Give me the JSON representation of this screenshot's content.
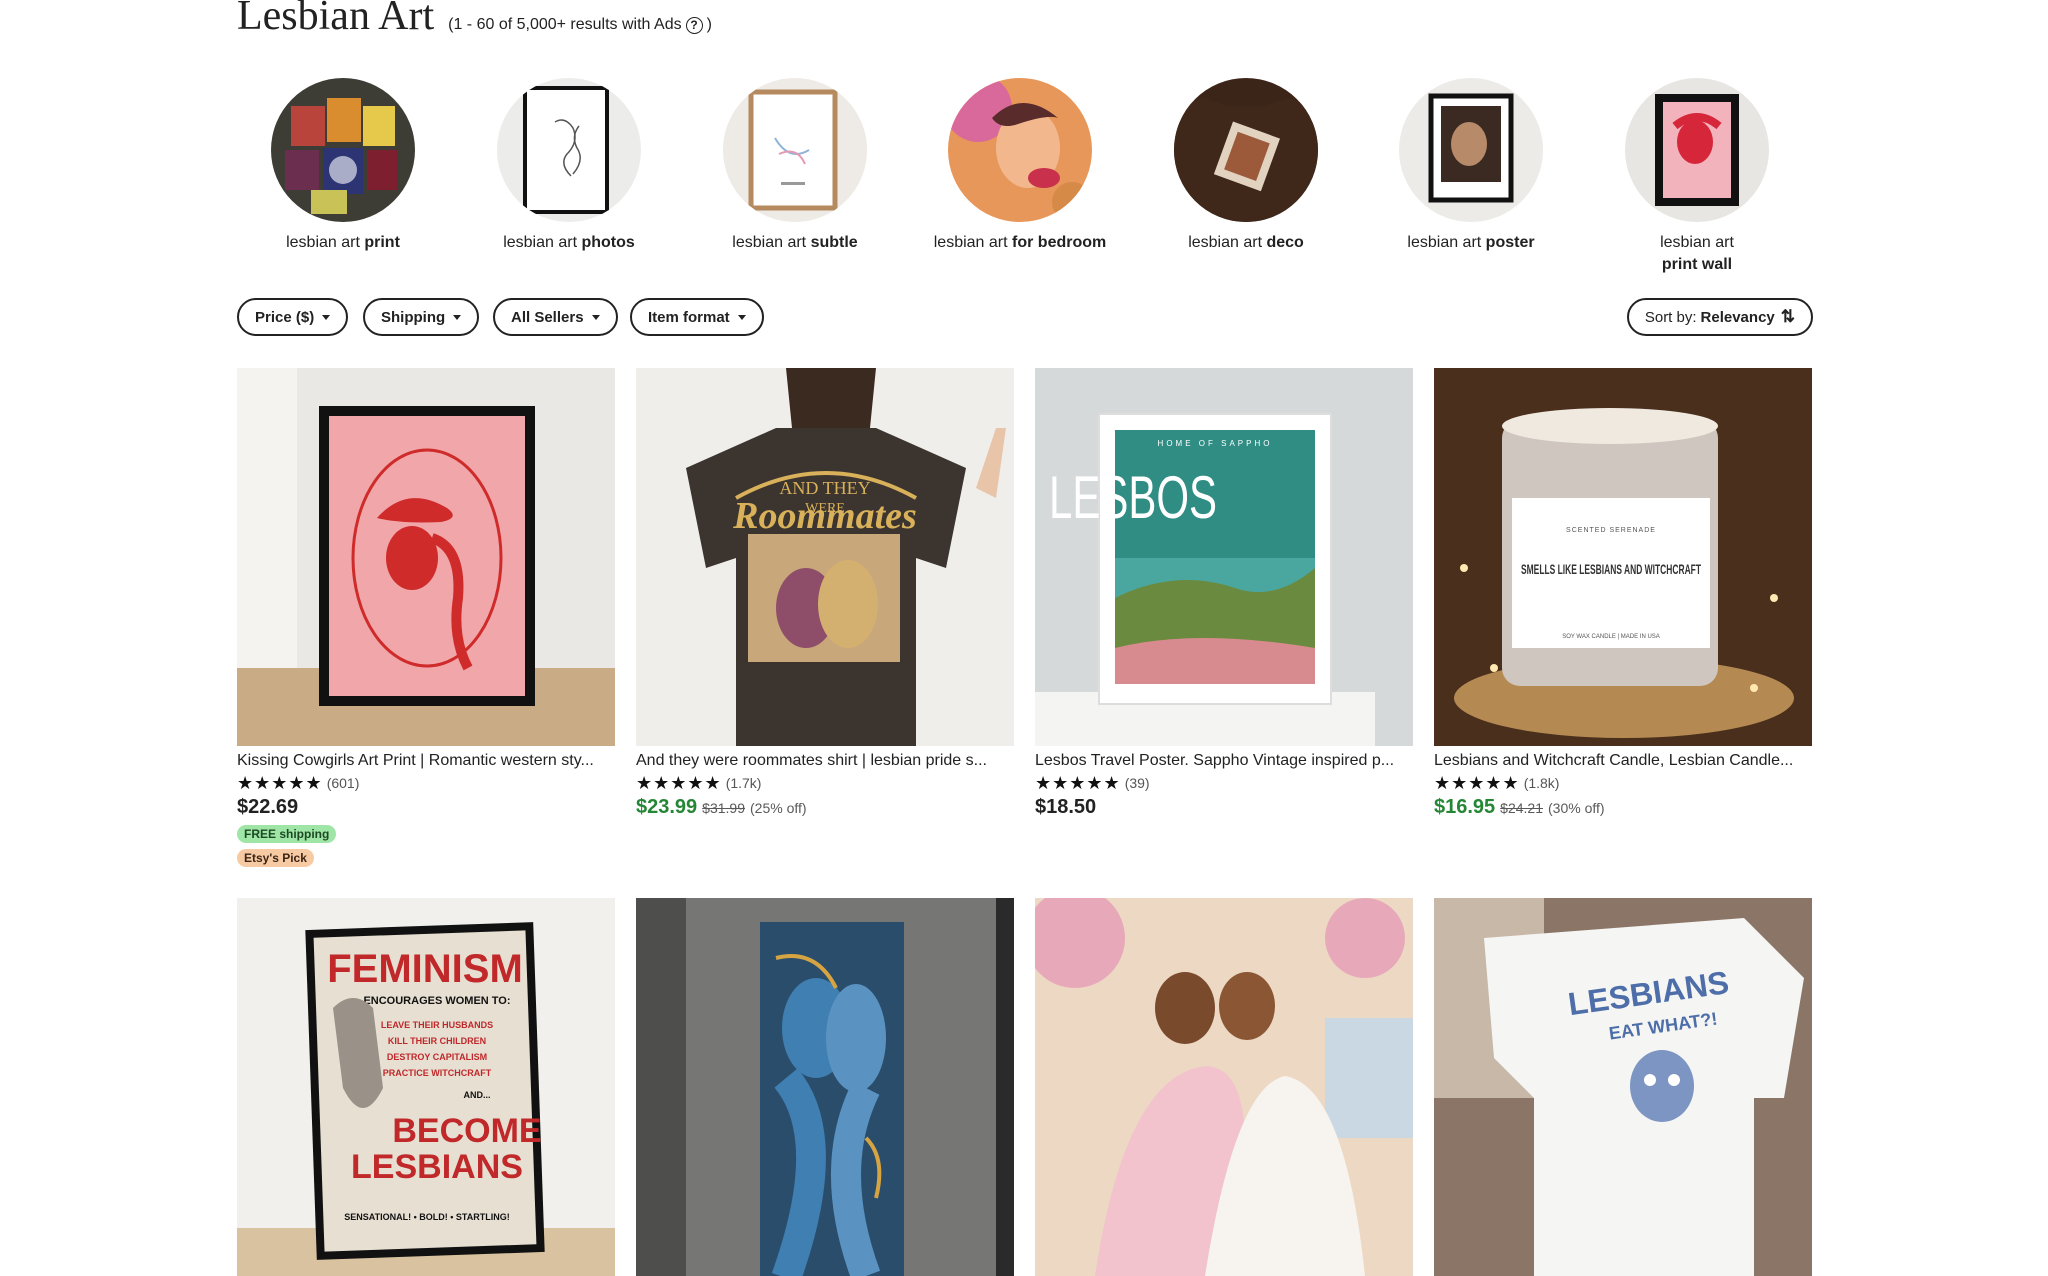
{
  "header": {
    "title": "Lesbian Art",
    "results": "(1 - 60 of 5,000+ results with Ads",
    "results_close": ")",
    "help_glyph": "?"
  },
  "related": [
    {
      "prefix": "lesbian art ",
      "bold": "print",
      "icon": "print-thumb"
    },
    {
      "prefix": "lesbian art ",
      "bold": "photos",
      "icon": "photos-thumb"
    },
    {
      "prefix": "lesbian art ",
      "bold": "subtle",
      "icon": "subtle-thumb"
    },
    {
      "prefix": "lesbian art ",
      "bold": "for bedroom",
      "icon": "bedroom-thumb"
    },
    {
      "prefix": "lesbian art ",
      "bold": "deco",
      "icon": "deco-thumb"
    },
    {
      "prefix": "lesbian art ",
      "bold": "poster",
      "icon": "poster-thumb"
    },
    {
      "prefix": "lesbian art ",
      "bold": "print wall",
      "icon": "print-wall-thumb"
    }
  ],
  "filters": {
    "price": "Price ($)",
    "shipping": "Shipping",
    "sellers": "All Sellers",
    "format": "Item format",
    "sort_label": "Sort by:",
    "sort_value": "Relevancy",
    "sort_icon": "⇅"
  },
  "listings": [
    {
      "title": "Kissing Cowgirls Art Print | Romantic western sty...",
      "stars": "★★★★★",
      "reviews": "(601)",
      "price": "$22.69",
      "orig": "",
      "off": "",
      "badge_ship": "FREE shipping",
      "badge_pick": "Etsy's Pick"
    },
    {
      "title": "And they were roommates shirt | lesbian pride s...",
      "stars": "★★★★★",
      "reviews": "(1.7k)",
      "price": "$23.99",
      "orig": "$31.99",
      "off": "(25% off)",
      "shirt_line1": "AND THEY",
      "shirt_line2": "WERE",
      "shirt_line3": "Roommates"
    },
    {
      "title": "Lesbos Travel Poster. Sappho Vintage inspired p...",
      "stars": "★★★★★",
      "reviews": "(39)",
      "price": "$18.50",
      "orig": "",
      "off": "",
      "poster_top": "HOME OF SAPPHO",
      "poster_word": "LESBOS"
    },
    {
      "title": "Lesbians and Witchcraft Candle, Lesbian Candle...",
      "stars": "★★★★★",
      "reviews": "(1.8k)",
      "price": "$16.95",
      "orig": "$24.21",
      "off": "(30% off)",
      "candle_brand": "SCENTED SERENADE",
      "candle_text": "SMELLS LIKE LESBIANS AND WITCHCRAFT",
      "candle_foot": "SOY WAX CANDLE | MADE IN USA"
    }
  ],
  "row2": {
    "feminism_title": "FEMINISM",
    "feminism_sub": "ENCOURAGES WOMEN TO:",
    "feminism_l1": "LEAVE THEIR HUSBANDS",
    "feminism_l2": "KILL THEIR CHILDREN",
    "feminism_l3": "DESTROY CAPITALISM",
    "feminism_l4": "PRACTICE WITCHCRAFT",
    "feminism_and": "AND...",
    "feminism_big1": "BECOME",
    "feminism_big2": "LESBIANS",
    "feminism_foot": "SENSATIONAL! • BOLD! • STARTLING!",
    "tee_line1": "LESBIANS",
    "tee_line2": "EAT WHAT?!"
  }
}
